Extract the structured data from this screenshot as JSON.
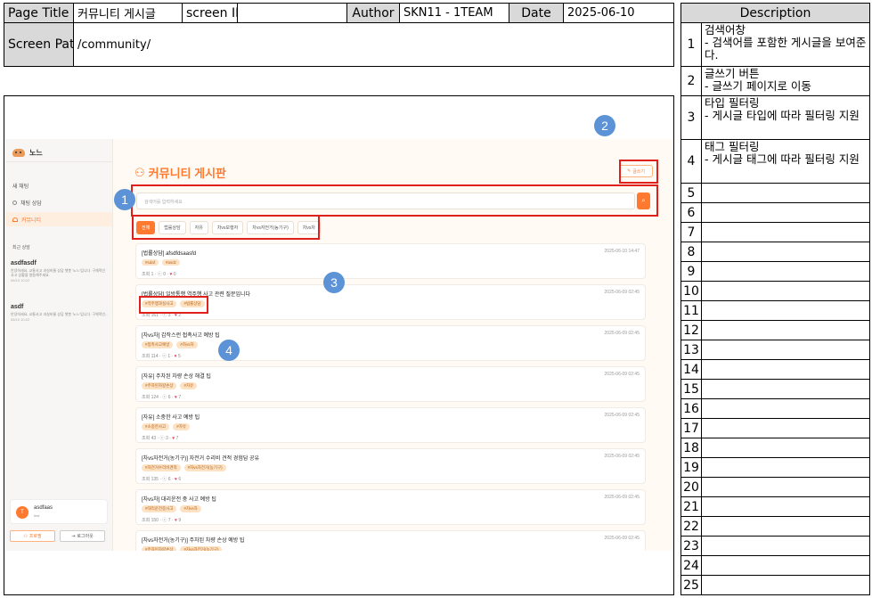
{
  "header": {
    "page_title_label": "Page Title",
    "page_title_value": "커뮤니티 게시글",
    "screen_id_label": "screen ID",
    "screen_id_value": "",
    "author_label": "Author",
    "author_value": "SKN11 - 1TEAM",
    "date_label": "Date",
    "date_value": "2025-06-10",
    "screen_path_label": "Screen Path",
    "screen_path_value": "/community/"
  },
  "description": {
    "title": "Description",
    "rows": [
      {
        "num": "1",
        "text": "검색어창\n- 검색어를 포함한 게시글을 보여준다."
      },
      {
        "num": "2",
        "text": "글쓰기 버튼\n- 글쓰기 페이지로 이동"
      },
      {
        "num": "3",
        "text": "타입 필터링\n- 게시글 타입에 따라 필터링 지원"
      },
      {
        "num": "4",
        "text": "태그 필터링\n- 게시글 태그에 따라 필터링 지원"
      },
      {
        "num": "5",
        "text": ""
      },
      {
        "num": "6",
        "text": ""
      },
      {
        "num": "7",
        "text": ""
      },
      {
        "num": "8",
        "text": ""
      },
      {
        "num": "9",
        "text": ""
      },
      {
        "num": "10",
        "text": ""
      },
      {
        "num": "11",
        "text": ""
      },
      {
        "num": "12",
        "text": ""
      },
      {
        "num": "13",
        "text": ""
      },
      {
        "num": "14",
        "text": ""
      },
      {
        "num": "15",
        "text": ""
      },
      {
        "num": "16",
        "text": ""
      },
      {
        "num": "17",
        "text": ""
      },
      {
        "num": "18",
        "text": ""
      },
      {
        "num": "19",
        "text": ""
      },
      {
        "num": "20",
        "text": ""
      },
      {
        "num": "21",
        "text": ""
      },
      {
        "num": "22",
        "text": ""
      },
      {
        "num": "23",
        "text": ""
      },
      {
        "num": "24",
        "text": ""
      },
      {
        "num": "25",
        "text": ""
      }
    ]
  },
  "markers": [
    "1",
    "2",
    "3",
    "4"
  ],
  "app": {
    "logo_text": "노느",
    "sidebar": {
      "new_chat": "새 채팅",
      "items": [
        {
          "label": "채팅 상담",
          "icon": "chat-icon"
        },
        {
          "label": "커뮤니티",
          "icon": "community-icon"
        }
      ],
      "recent_label": "최근 상담",
      "recent": [
        {
          "title": "asdfasdf",
          "preview": "안녕하세요, 교통사고 과실비율 상담 챗봇 '노느'입니다. 구체적인 사고 상황을 말씀해주세요.",
          "time": "06/10 10:22"
        },
        {
          "title": "asdf",
          "preview": "안녕하세요, 교통사고 과실비율 상담 챗봇 '노느'입니다. 구체적인...",
          "time": "06/10 10:22"
        }
      ],
      "user": {
        "avatar": "T",
        "name": "asdfaas",
        "sub": "test"
      },
      "profile_button": "프로필",
      "logout_button": "로그아웃"
    },
    "main": {
      "title": "커뮤니티 게시판",
      "write_button": "글쓰기",
      "search_placeholder": "검색어를 입력하세요",
      "type_filters": [
        "전체",
        "법률상담",
        "자유",
        "차vs보행자",
        "차vs자전거(농기구)",
        "차vs차"
      ],
      "posts": [
        {
          "title": "[법률상담] afsdfdsaasfd",
          "date": "2025-06-10 14:47",
          "tags": [
            "#sdaf",
            "#asdz"
          ],
          "meta": "조회 1 · ⓒ 0 ·",
          "likes": "0"
        },
        {
          "title": "[법률상담] 일방통행 역주행 사고 관련 질문입니다",
          "date": "2025-06-09 02:45",
          "tags": [
            "#역주행과실사고",
            "#법률상담"
          ],
          "meta": "조회 161 · ⓒ 3 ·",
          "likes": "2"
        },
        {
          "title": "[차vs차] 갑작스런 접촉사고 예방 팁",
          "date": "2025-06-09 02:45",
          "tags": [
            "#접촉사고예방",
            "#차vs차"
          ],
          "meta": "조회 114 · ⓒ 1 ·",
          "likes": "5"
        },
        {
          "title": "[자유] 주차된 차량 손상 해결 팁",
          "date": "2025-06-09 02:45",
          "tags": [
            "#주차된차량손상",
            "#자유"
          ],
          "meta": "조회 124 · ⓒ 6 ·",
          "likes": "7"
        },
        {
          "title": "[자유] 소중한 사고 예방 팁",
          "date": "2025-06-09 02:45",
          "tags": [
            "#소중한사고",
            "#자유"
          ],
          "meta": "조회 43 · ⓒ 3 ·",
          "likes": "7"
        },
        {
          "title": "[차vs자전거(농기구)] 자전거 수리비 견적 경험담 공유",
          "date": "2025-06-09 02:45",
          "tags": [
            "#자전거수리비견적",
            "#차vs자전거(농기구)"
          ],
          "meta": "조회 135 · ⓒ 6 ·",
          "likes": "6"
        },
        {
          "title": "[차vs차] 대리운전 중 사고 예방 팁",
          "date": "2025-06-09 02:45",
          "tags": [
            "#대리운전중사고",
            "#차vs차"
          ],
          "meta": "조회 150 · ⓒ 7 ·",
          "likes": "9"
        },
        {
          "title": "[차vs자전거(농기구)] 주차된 차량 손상 예방 팁",
          "date": "2025-06-09 02:45",
          "tags": [
            "#주차된차량손상",
            "#차vs자전거(농기구)"
          ],
          "meta": "조회 98 · ⓒ 2 ·",
          "likes": "4"
        }
      ]
    }
  }
}
